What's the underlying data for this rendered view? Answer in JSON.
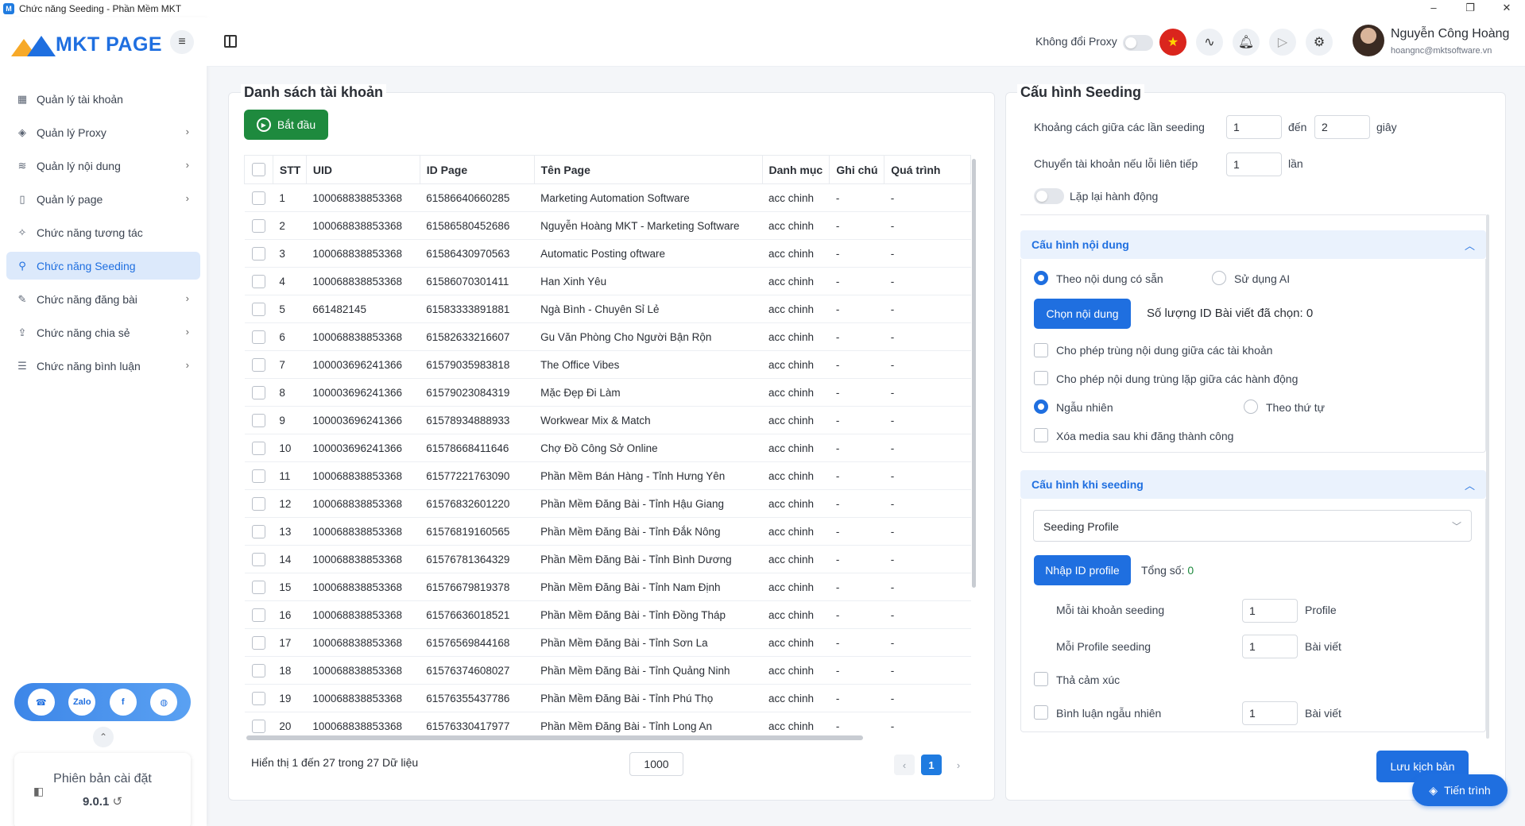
{
  "window": {
    "title": "Chức năng Seeding - Phần Mềm MKT",
    "controls": [
      "–",
      "❐",
      "✕"
    ]
  },
  "brand": {
    "name": "MKT PAGE"
  },
  "sidebar": {
    "items": [
      {
        "label": "Quản lý tài khoản",
        "icon": "grid-icon",
        "glyph": "▦",
        "has_chevron": false
      },
      {
        "label": "Quản lý Proxy",
        "icon": "layers-icon",
        "glyph": "◈",
        "has_chevron": true
      },
      {
        "label": "Quản lý nội dung",
        "icon": "stack-icon",
        "glyph": "≋",
        "has_chevron": true
      },
      {
        "label": "Quản lý page",
        "icon": "page-icon",
        "glyph": "▯",
        "has_chevron": true
      },
      {
        "label": "Chức năng tương tác",
        "icon": "interact-icon",
        "glyph": "✧",
        "has_chevron": false
      },
      {
        "label": "Chức năng Seeding",
        "icon": "seeding-icon",
        "glyph": "⚲",
        "has_chevron": false,
        "active": true
      },
      {
        "label": "Chức năng đăng bài",
        "icon": "post-icon",
        "glyph": "✎",
        "has_chevron": true
      },
      {
        "label": "Chức năng chia sẻ",
        "icon": "share-icon",
        "glyph": "⇪",
        "has_chevron": true
      },
      {
        "label": "Chức năng bình luận",
        "icon": "comment-icon",
        "glyph": "☰",
        "has_chevron": true
      }
    ],
    "social": [
      "support-icon",
      "zalo-icon",
      "facebook-icon",
      "globe-icon"
    ],
    "social_glyphs": [
      "☎",
      "Zalo",
      "f",
      "◍"
    ],
    "version_title": "Phiên bản cài đặt",
    "version_number": "9.0.1"
  },
  "header": {
    "proxy_label": "Không đổi Proxy",
    "user_name": "Nguyễn Công Hoàng",
    "user_email": "hoangnc@mktsoftware.vn"
  },
  "accounts": {
    "title": "Danh sách tài khoản",
    "start_label": "Bắt đầu",
    "columns": [
      "STT",
      "UID",
      "ID Page",
      "Tên Page",
      "Danh mục",
      "Ghi chú",
      "Quá trình"
    ],
    "rows": [
      [
        "1",
        "100068838853368",
        "61586640660285",
        "Marketing Automation Software",
        "acc chinh",
        "-",
        "-"
      ],
      [
        "2",
        "100068838853368",
        "61586580452686",
        "Nguyễn Hoàng MKT - Marketing Software",
        "acc chinh",
        "-",
        "-"
      ],
      [
        "3",
        "100068838853368",
        "61586430970563",
        "Automatic Posting oftware",
        "acc chinh",
        "-",
        "-"
      ],
      [
        "4",
        "100068838853368",
        "61586070301411",
        "Han Xinh Yêu",
        "acc chinh",
        "-",
        "-"
      ],
      [
        "5",
        "661482145",
        "61583333891881",
        "Ngà Bình - Chuyên Sỉ Lẻ",
        "acc chinh",
        "-",
        "-"
      ],
      [
        "6",
        "100068838853368",
        "61582633216607",
        "Gu Văn Phòng Cho Người Bận Rộn",
        "acc chinh",
        "-",
        "-"
      ],
      [
        "7",
        "100003696241366",
        "61579035983818",
        "The Office Vibes",
        "acc chinh",
        "-",
        "-"
      ],
      [
        "8",
        "100003696241366",
        "61579023084319",
        "Mặc Đẹp Đi Làm",
        "acc chinh",
        "-",
        "-"
      ],
      [
        "9",
        "100003696241366",
        "61578934888933",
        "Workwear Mix & Match",
        "acc chinh",
        "-",
        "-"
      ],
      [
        "10",
        "100003696241366",
        "61578668411646",
        "Chợ Đồ Công Sở Online",
        "acc chinh",
        "-",
        "-"
      ],
      [
        "11",
        "100068838853368",
        "61577221763090",
        "Phần Mềm Bán Hàng - Tỉnh Hưng Yên",
        "acc chinh",
        "-",
        "-"
      ],
      [
        "12",
        "100068838853368",
        "61576832601220",
        "Phần Mềm Đăng Bài - Tỉnh Hậu Giang",
        "acc chinh",
        "-",
        "-"
      ],
      [
        "13",
        "100068838853368",
        "61576819160565",
        "Phần Mềm Đăng Bài - Tỉnh Đắk Nông",
        "acc chinh",
        "-",
        "-"
      ],
      [
        "14",
        "100068838853368",
        "61576781364329",
        "Phần Mềm Đăng Bài - Tỉnh Bình Dương",
        "acc chinh",
        "-",
        "-"
      ],
      [
        "15",
        "100068838853368",
        "61576679819378",
        "Phần Mềm Đăng Bài - Tỉnh Nam Định",
        "acc chinh",
        "-",
        "-"
      ],
      [
        "16",
        "100068838853368",
        "61576636018521",
        "Phần Mềm Đăng Bài - Tỉnh Đồng Tháp",
        "acc chinh",
        "-",
        "-"
      ],
      [
        "17",
        "100068838853368",
        "61576569844168",
        "Phần Mềm Đăng Bài - Tỉnh Sơn La",
        "acc chinh",
        "-",
        "-"
      ],
      [
        "18",
        "100068838853368",
        "61576374608027",
        "Phần Mềm Đăng Bài - Tỉnh Quảng Ninh",
        "acc chinh",
        "-",
        "-"
      ],
      [
        "19",
        "100068838853368",
        "61576355437786",
        "Phần Mềm Đăng Bài - Tỉnh Phú Thọ",
        "acc chinh",
        "-",
        "-"
      ],
      [
        "20",
        "100068838853368",
        "61576330417977",
        "Phần Mềm Đăng Bài - Tỉnh Long An",
        "acc chinh",
        "-",
        "-"
      ]
    ],
    "footer_text": "Hiển thị 1 đến 27 trong 27 Dữ liệu",
    "page_size": "1000",
    "current_page": "1"
  },
  "seeding": {
    "title": "Cấu hình Seeding",
    "interval_label": "Khoảng cách giữa các lần seeding",
    "interval_from": "1",
    "interval_to_label": "đến",
    "interval_to": "2",
    "interval_unit": "giây",
    "switch_label": "Chuyển tài khoản nếu lỗi liên tiếp",
    "switch_value": "1",
    "switch_unit": "lần",
    "repeat_label": "Lặp lại hành động",
    "content_section": {
      "title": "Cấu hình nội dung",
      "opt_available": "Theo nội dung có sẵn",
      "opt_ai": "Sử dụng AI",
      "choose_button": "Chọn nội dung",
      "count_text": "Số lượng ID Bài viết đã chọn: 0",
      "allow_dup_accounts": "Cho phép trùng nội dung giữa các tài khoản",
      "allow_dup_actions": "Cho phép nội dung trùng lặp giữa các hành động",
      "opt_random": "Ngẫu nhiên",
      "opt_sequential": "Theo thứ tự",
      "delete_media": "Xóa media sau khi đăng thành công"
    },
    "when_section": {
      "title": "Cấu hình khi seeding",
      "select_value": "Seeding Profile",
      "import_button": "Nhập ID profile",
      "total_label": "Tổng số:",
      "total_value": "0",
      "per_account_label": "Mỗi tài khoản seeding",
      "per_account_value": "1",
      "per_account_unit": "Profile",
      "per_profile_label": "Mỗi Profile seeding",
      "per_profile_value": "1",
      "per_profile_unit": "Bài viết",
      "react_label": "Thả cảm xúc",
      "random_comment_label": "Bình luận ngẫu nhiên",
      "random_comment_value": "1",
      "random_comment_unit": "Bài viết"
    },
    "save_button": "Lưu kịch bản"
  },
  "fab": {
    "label": "Tiến trình"
  },
  "colors": {
    "accent": "#1f6fe0",
    "start_green": "#1e8a3e",
    "active_bg": "#dce9fb"
  }
}
